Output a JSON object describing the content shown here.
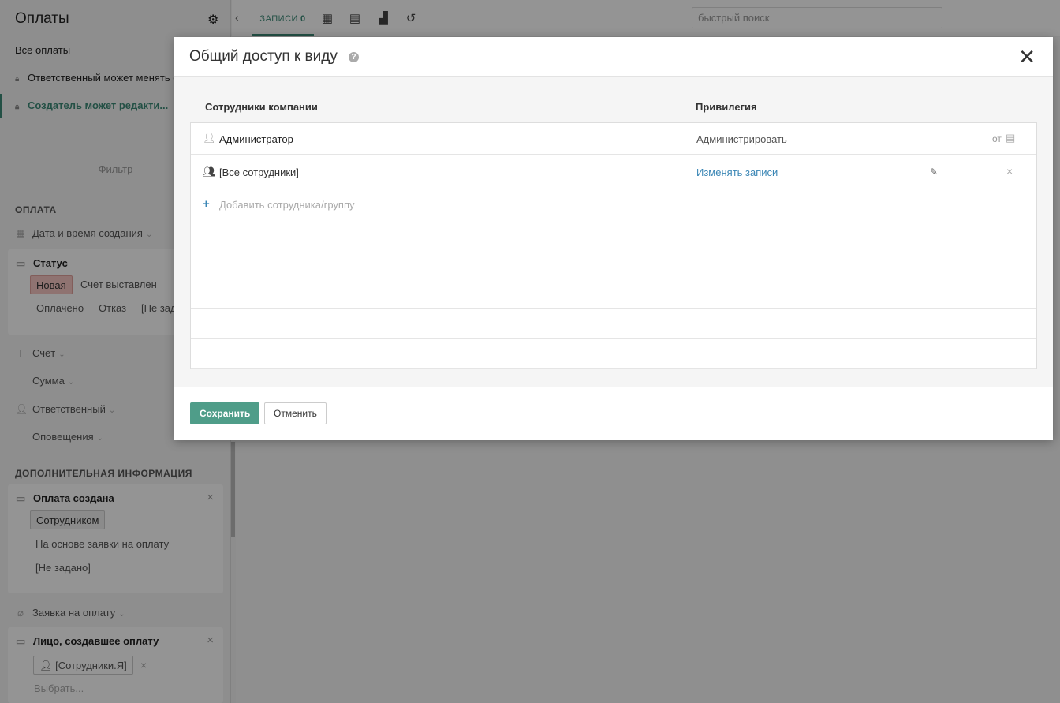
{
  "sidebar": {
    "title": "Оплаты",
    "views": [
      {
        "label": "Все оплаты"
      },
      {
        "label": "Ответственный может менять с"
      },
      {
        "label": "Создатель может редакти..."
      }
    ],
    "filter_tab": "Фильтр",
    "section_payment": "ОПЛАТА",
    "field_created": "Дата и время создания",
    "status": {
      "title": "Статус",
      "options": [
        "Новая",
        "Счет выставлен",
        "Оплачено",
        "Отказ",
        "[Не зад"
      ]
    },
    "field_invoice": "Счёт",
    "field_sum": "Сумма",
    "field_responsible": "Ответственный",
    "field_notifications": "Оповещения",
    "section_extra": "ДОПОЛНИТЕЛЬНАЯ ИНФОРМАЦИЯ",
    "created_by": {
      "title": "Оплата создана",
      "options": [
        "Сотрудником",
        "На основе заявки на оплату",
        "[Не задано]"
      ]
    },
    "field_request": "Заявка на оплату",
    "creator": {
      "title": "Лицо, создавшее оплату",
      "chip": "[Сотрудники.Я]",
      "choose": "Выбрать..."
    }
  },
  "topbar": {
    "tab_records_label": "ЗАПИСИ",
    "tab_records_count": "0",
    "search_placeholder": "быстрый поиск"
  },
  "modal": {
    "title": "Общий доступ к виду",
    "col_employees": "Сотрудники компании",
    "col_privilege": "Привилегия",
    "rows": [
      {
        "name": "Администратор",
        "privilege": "Администрировать",
        "extra": "от"
      },
      {
        "name": "[Все сотрудники]",
        "privilege": "Изменять записи"
      }
    ],
    "add_label": "Добавить сотрудника/группу",
    "save_label": "Сохранить",
    "cancel_label": "Отменить"
  },
  "colors": {
    "accent": "#3d8b78",
    "save_button": "#4f9d89",
    "link": "#3a86b5",
    "status_new": "#f6c7c3"
  }
}
